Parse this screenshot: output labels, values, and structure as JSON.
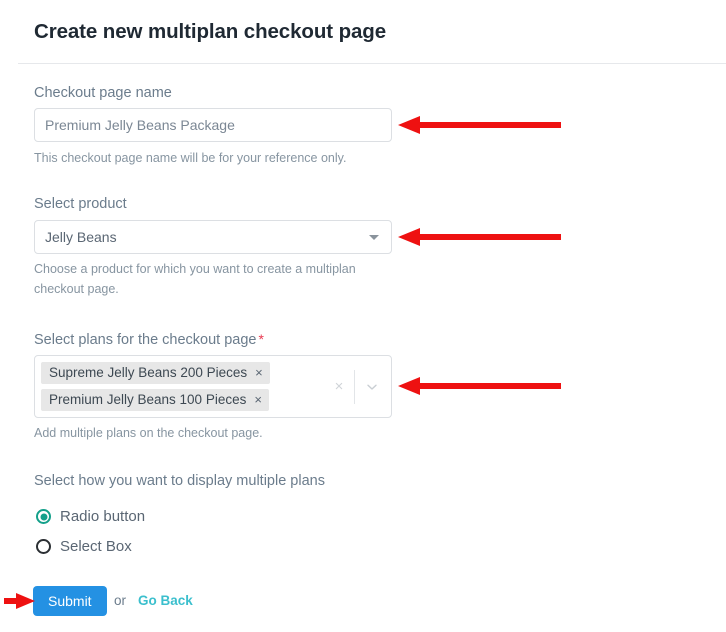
{
  "header": {
    "title": "Create new multiplan checkout page"
  },
  "form": {
    "name_field": {
      "label": "Checkout page name",
      "value": "Premium Jelly Beans Package",
      "placeholder": "Premium Jelly Beans Package",
      "help": "This checkout page name will be for your reference only."
    },
    "product_field": {
      "label": "Select product",
      "selected": "Jelly Beans",
      "help": "Choose a product for which you want to create a multiplan checkout page.",
      "caret_icon": "caret-down-icon"
    },
    "plans_field": {
      "label": "Select plans for the checkout page",
      "required_marker": "*",
      "help": "Add multiple plans on the checkout page.",
      "tags": [
        {
          "label": "Supreme Jelly Beans 200 Pieces",
          "remove_icon": "×"
        },
        {
          "label": "Premium Jelly Beans 100 Pieces",
          "remove_icon": "×"
        }
      ],
      "clear_icon": "×",
      "dropdown_icon": "chevron-down-icon"
    },
    "display_mode": {
      "label": "Select how you want to display multiple plans",
      "options": [
        {
          "label": "Radio button",
          "selected": true
        },
        {
          "label": "Select Box",
          "selected": false
        }
      ]
    }
  },
  "actions": {
    "submit_label": "Submit",
    "or_label": "or",
    "go_back_label": "Go Back"
  },
  "colors": {
    "accent_blue": "#2491e3",
    "link_teal": "#3bbfcd",
    "radio_teal": "#14a08a",
    "required_red": "#e8384f",
    "annotation_red": "#ee1111",
    "tag_bg": "#e7e7e7",
    "border": "#dcdfe3"
  },
  "annotations": {
    "arrows": [
      {
        "name": "arrow-to-name-field",
        "direction": "left"
      },
      {
        "name": "arrow-to-product-select",
        "direction": "left"
      },
      {
        "name": "arrow-to-plans-select",
        "direction": "left"
      },
      {
        "name": "arrow-to-submit-button",
        "direction": "right"
      }
    ]
  }
}
